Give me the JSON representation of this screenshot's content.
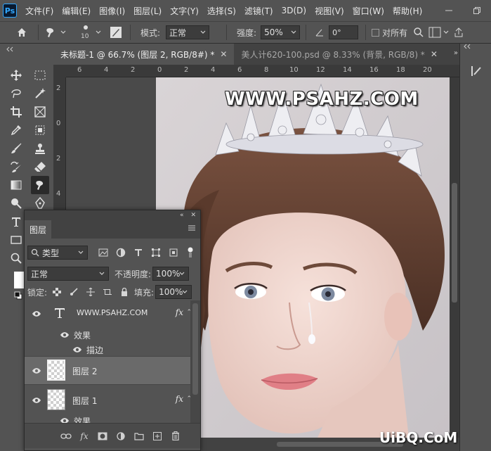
{
  "menu": {
    "logo": "Ps",
    "items": [
      "文件(F)",
      "编辑(E)",
      "图像(I)",
      "图层(L)",
      "文字(Y)",
      "选择(S)",
      "滤镜(T)",
      "3D(D)",
      "视图(V)",
      "窗口(W)",
      "帮助(H)"
    ]
  },
  "options": {
    "brush_size": "10",
    "mode_label": "模式:",
    "mode_value": "正常",
    "strength_label": "强度:",
    "strength_value": "50%",
    "angle_value": "0°",
    "sample_all_label": "对所有"
  },
  "tabs": [
    {
      "label": "未标题-1 @ 66.7% (图层 2, RGB/8#) *"
    },
    {
      "label": "美人计620-100.psd @ 8.33% (背景, RGB/8) *"
    }
  ],
  "ruler": {
    "top": [
      "6",
      "4",
      "2",
      "0",
      "2",
      "4",
      "6",
      "8",
      "10",
      "12",
      "14",
      "16",
      "18",
      "20"
    ],
    "left": [
      "2",
      "0",
      "2",
      "4"
    ]
  },
  "canvas": {
    "watermark": "WWW.PSAHZ.COM"
  },
  "layers_panel": {
    "tab": "图层",
    "filter_value": "类型",
    "blend_mode": "正常",
    "opacity_label": "不透明度:",
    "opacity_value": "100%",
    "lock_label": "锁定:",
    "fill_label": "填充:",
    "fill_value": "100%",
    "layers": [
      {
        "name": "WWW.PSAHZ.COM",
        "type": "text",
        "fx": "fx",
        "effects_label": "效果",
        "effect": "描边"
      },
      {
        "name": "图层 2",
        "type": "pixel",
        "selected": true
      },
      {
        "name": "图层 1",
        "type": "pixel",
        "fx": "fx",
        "effects_label": "效果"
      }
    ]
  },
  "site_mark": "UiBQ.CoM",
  "colors": {
    "accent": "#31a8ff",
    "chrome_dark": "#424242",
    "chrome": "#535353"
  }
}
